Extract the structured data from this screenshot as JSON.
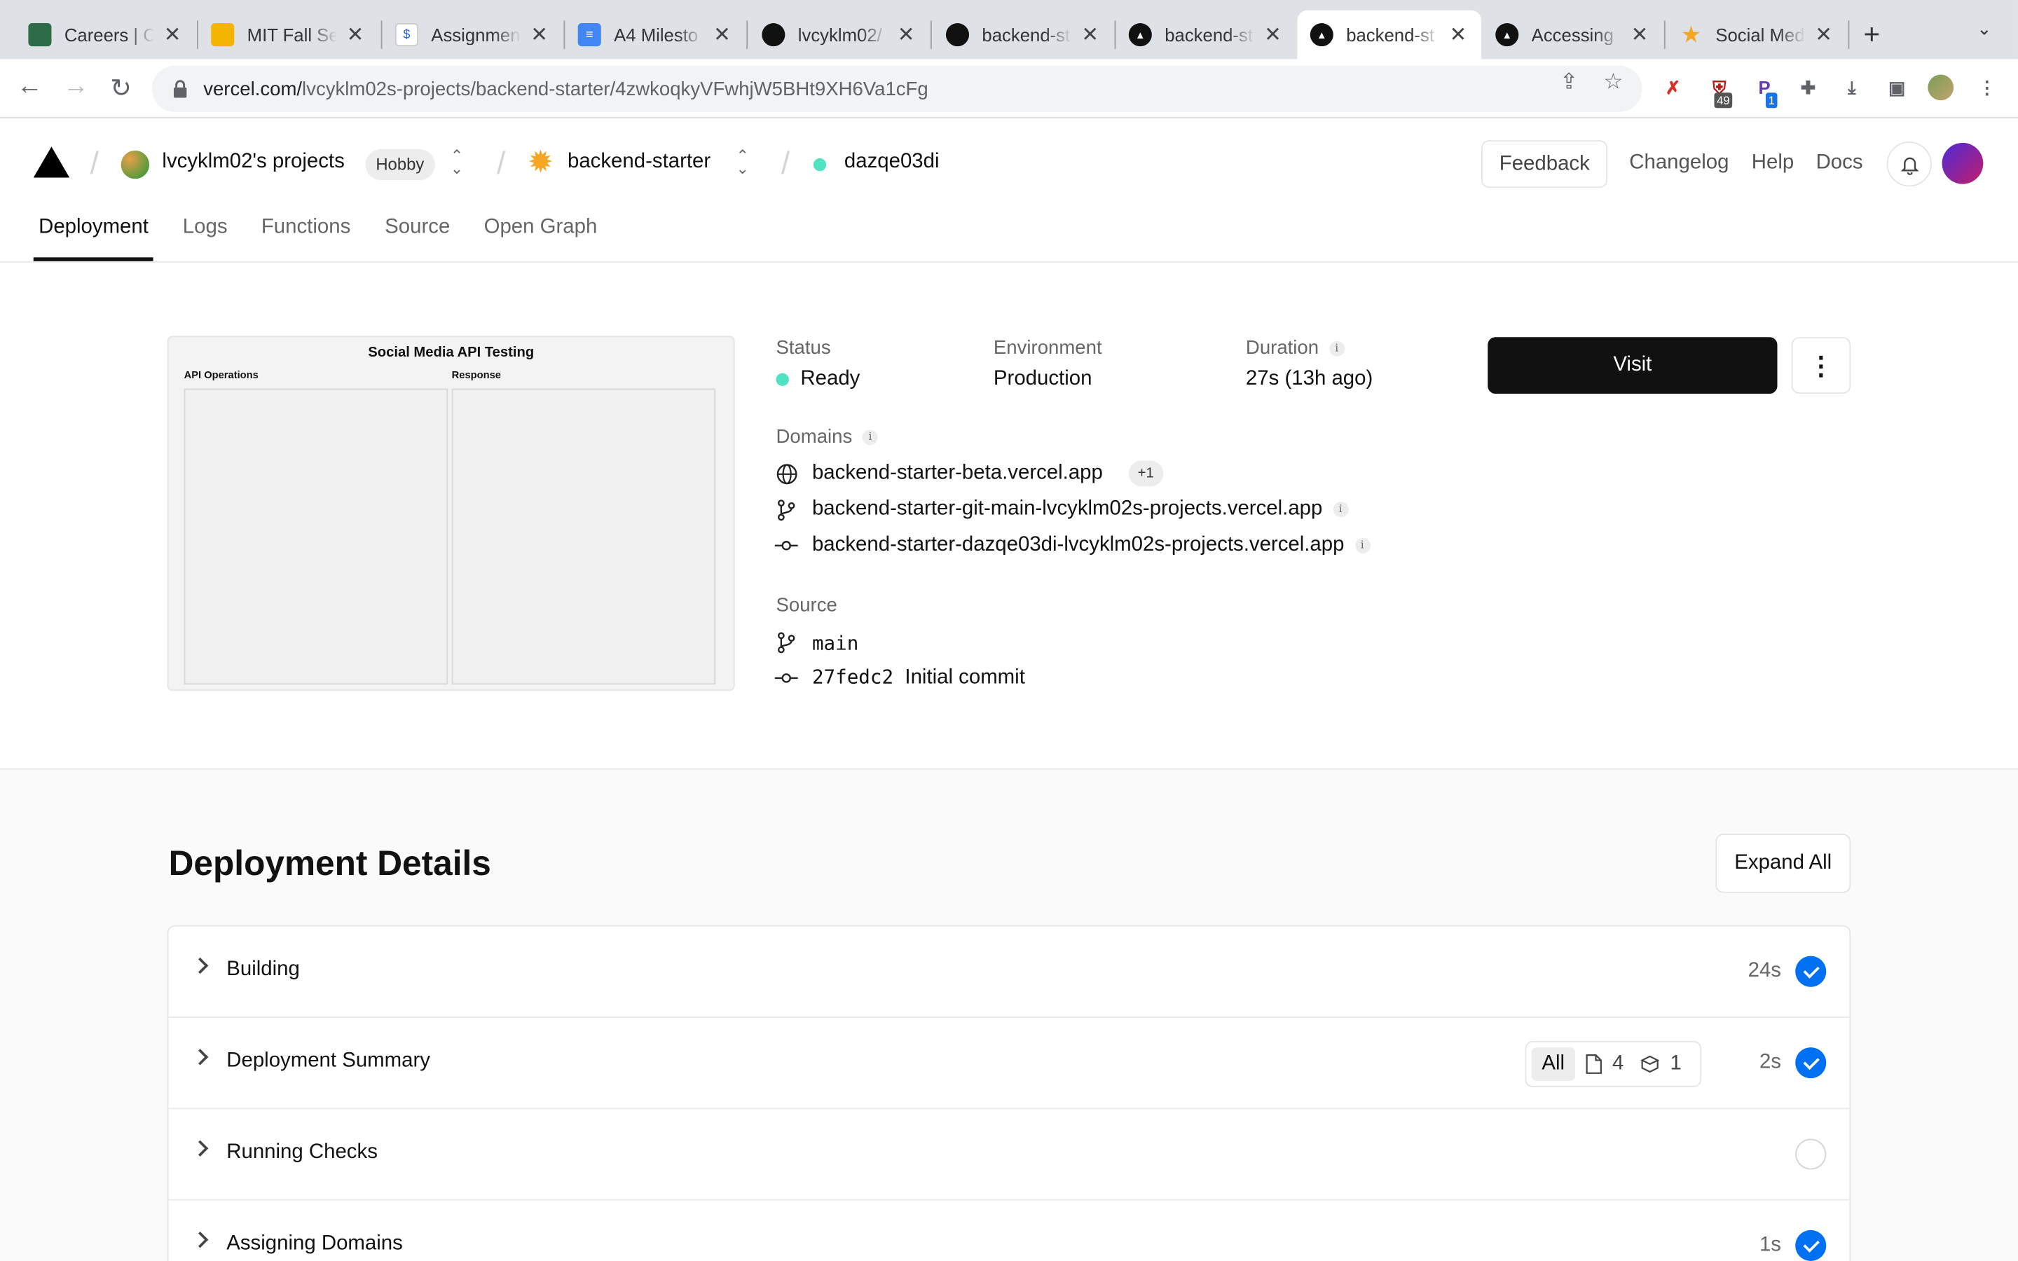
{
  "browser": {
    "tabs": [
      {
        "title": "Careers | C",
        "fav_color": "#2e6b47"
      },
      {
        "title": "MIT Fall Se",
        "fav_color": "#f4b400"
      },
      {
        "title": "Assignmen",
        "fav_color": "#3367d6"
      },
      {
        "title": "A4 Milesto",
        "fav_color": "#4285f4"
      },
      {
        "title": "lvcyklm02/",
        "fav_color": "#111111"
      },
      {
        "title": "backend-st",
        "fav_color": "#111111"
      },
      {
        "title": "backend-st",
        "fav_color": "#111111"
      },
      {
        "title": "backend-st",
        "fav_color": "#111111",
        "active": true
      },
      {
        "title": "Accessing",
        "fav_color": "#111111"
      },
      {
        "title": "Social Med",
        "fav_color": "#f5a623"
      }
    ],
    "url_host": "vercel.com/",
    "url_path": "lvcyklm02s-projects/backend-starter/4zwkoqkyVFwhjW5BHt9XH6Va1cFg",
    "ext_badges": {
      "shield": "49",
      "p": "1"
    }
  },
  "header": {
    "team_name": "lvcyklm02's projects",
    "plan_badge": "Hobby",
    "project_name": "backend-starter",
    "deployment_id": "dazqe03di",
    "feedback": "Feedback",
    "changelog": "Changelog",
    "help": "Help",
    "docs": "Docs"
  },
  "tabs": [
    "Deployment",
    "Logs",
    "Functions",
    "Source",
    "Open Graph"
  ],
  "preview": {
    "title": "Social Media API Testing",
    "col1": "API Operations",
    "col2": "Response"
  },
  "summary": {
    "status_label": "Status",
    "status_value": "Ready",
    "env_label": "Environment",
    "env_value": "Production",
    "duration_label": "Duration",
    "duration_value": "27s (13h ago)",
    "domains_label": "Domains",
    "domains": [
      "backend-starter-beta.vercel.app",
      "backend-starter-git-main-lvcyklm02s-projects.vercel.app",
      "backend-starter-dazqe03di-lvcyklm02s-projects.vercel.app"
    ],
    "domains_extra": "+1",
    "source_label": "Source",
    "branch": "main",
    "commit_sha": "27fedc2",
    "commit_msg": "Initial commit",
    "visit": "Visit"
  },
  "details": {
    "title": "Deployment Details",
    "expand_all": "Expand All",
    "rows": [
      {
        "label": "Building",
        "duration": "24s",
        "status": "done"
      },
      {
        "label": "Deployment Summary",
        "duration": "2s",
        "status": "done"
      },
      {
        "label": "Running Checks",
        "duration": "",
        "status": "pending"
      },
      {
        "label": "Assigning Domains",
        "duration": "1s",
        "status": "done"
      }
    ],
    "filter": {
      "all": "All",
      "files": "4",
      "functions": "1"
    }
  },
  "colors": {
    "accent": "#0070f3",
    "ready": "#50e3c2",
    "visit_bg": "#111111"
  }
}
